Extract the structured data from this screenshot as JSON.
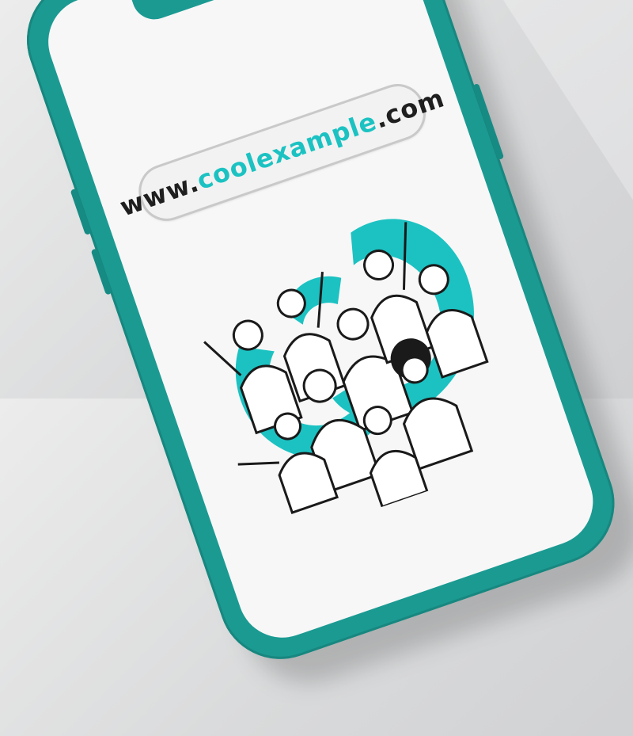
{
  "address_bar": {
    "prefix": "www.",
    "domain": "coolexample",
    "tld": ".com"
  },
  "colors": {
    "phone_body": "#1b9a92",
    "accent_teal": "#1cc2c2",
    "screen_bg": "#f7f7f7",
    "url_text": "#1f1f1f"
  },
  "illustration": {
    "subject": "crowd-of-cheering-people",
    "icon": "people-illustration"
  }
}
